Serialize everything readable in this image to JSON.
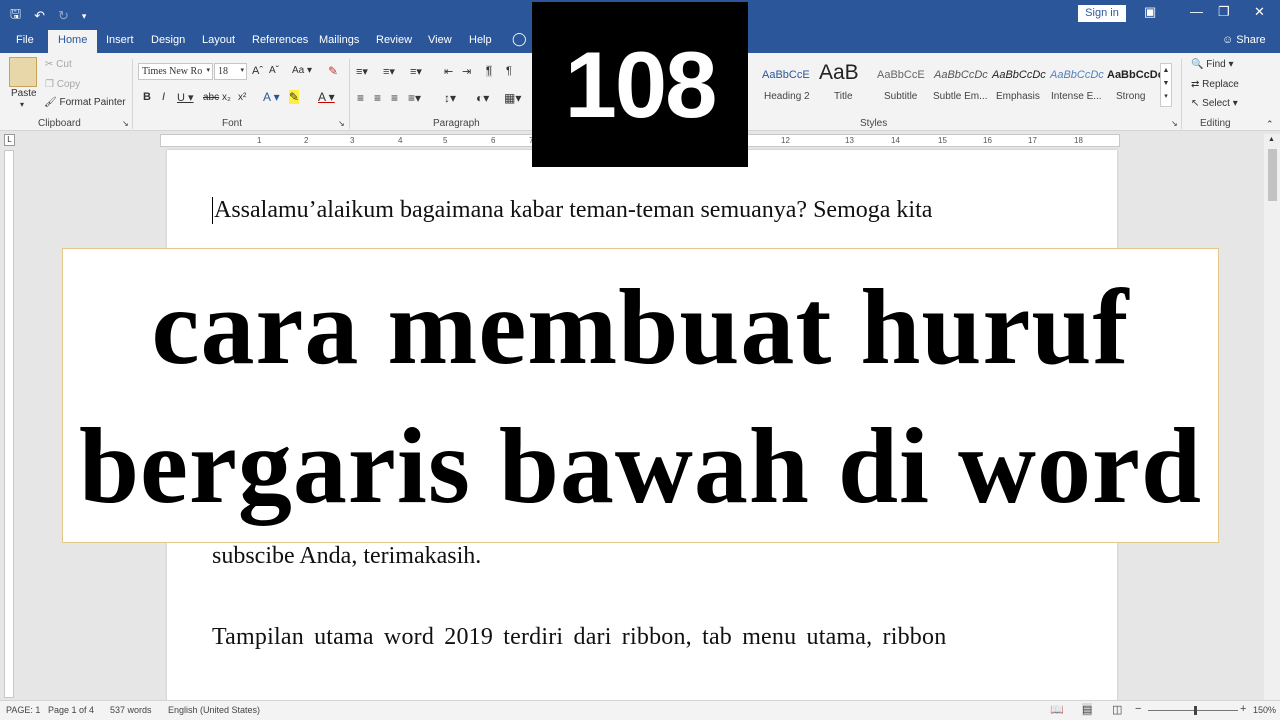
{
  "titlebar": {
    "signin": "Sign in",
    "restore_icon": "restore-icon",
    "max_icon": "maximize-icon",
    "close_icon": "close-icon"
  },
  "tabs": [
    {
      "label": "File"
    },
    {
      "label": "Home"
    },
    {
      "label": "Insert"
    },
    {
      "label": "Design"
    },
    {
      "label": "Layout"
    },
    {
      "label": "References"
    },
    {
      "label": "Mailings"
    },
    {
      "label": "Review"
    },
    {
      "label": "View"
    },
    {
      "label": "Help"
    }
  ],
  "share": "Share",
  "clipboard": {
    "paste": "Paste",
    "cut": "Cut",
    "copy": "Copy",
    "format_painter": "Format Painter",
    "label": "Clipboard"
  },
  "font": {
    "family": "Times New Ro",
    "size": "18",
    "label": "Font"
  },
  "paragraph": {
    "label": "Paragraph"
  },
  "styles": {
    "label": "Styles",
    "items": [
      {
        "sample": "AaBbCcE",
        "name": "Heading 2"
      },
      {
        "sample": "AaB",
        "name": "Title"
      },
      {
        "sample": "AaBbCcE",
        "name": "Subtitle"
      },
      {
        "sample": "AaBbCcDc",
        "name": "Subtle Em..."
      },
      {
        "sample": "AaBbCcDc",
        "name": "Emphasis"
      },
      {
        "sample": "AaBbCcDc",
        "name": "Intense E..."
      },
      {
        "sample": "AaBbCcDc",
        "name": "Strong"
      }
    ]
  },
  "editing": {
    "find": "Find",
    "replace": "Replace",
    "select": "Select",
    "label": "Editing"
  },
  "ruler_numbers": [
    "1",
    "2",
    "3",
    "4",
    "5",
    "6",
    "7",
    "12",
    "13",
    "14",
    "15",
    "16",
    "17",
    "18"
  ],
  "document": {
    "line1": "Assalamu’alaikum bagaimana kabar teman-teman semuanya? Semoga kita",
    "line2": "subscibe Anda, terimakasih.",
    "line3": "Tampilan utama word 2019 terdiri dari ribbon, tab menu utama, ribbon"
  },
  "overlay": {
    "number": "108",
    "title_line1": "cara membuat huruf",
    "title_line2": "bergaris bawah di word"
  },
  "status": {
    "page": "PAGE: 1",
    "page_of": "Page 1 of 4",
    "words": "537 words",
    "language": "English (United States)",
    "zoom": "150%"
  }
}
